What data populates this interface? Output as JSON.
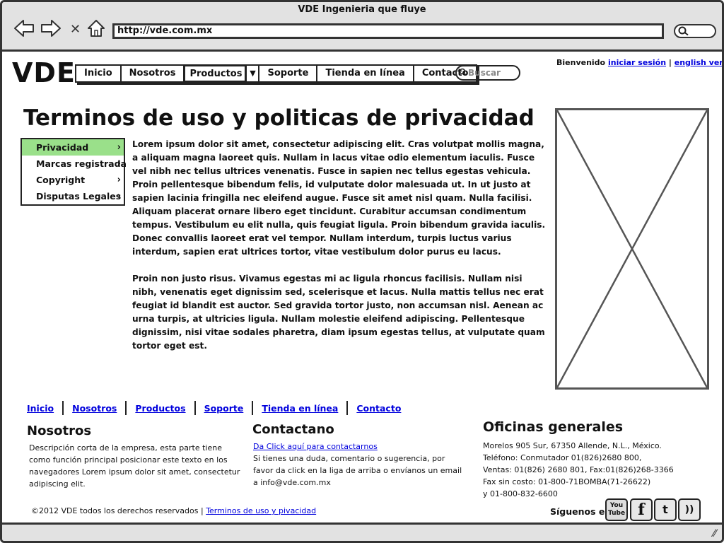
{
  "window": {
    "title": "VDE Ingenieria que fluye"
  },
  "browser": {
    "url": "http://vde.com.mx",
    "icons": [
      "back-arrow-icon",
      "forward-arrow-icon",
      "stop-icon",
      "home-icon",
      "search-icon"
    ],
    "stop_glyph": "✕"
  },
  "header": {
    "logo": "VDE",
    "nav": [
      "Inicio",
      "Nosotros",
      "Productos",
      "Soporte",
      "Tienda en línea",
      "Contacto"
    ],
    "search_placeholder": "Buscar",
    "welcome_text": "Bienvenido",
    "login_link": "iniciar sesión",
    "separator": "|",
    "english_link": "english version"
  },
  "main": {
    "title": "Terminos de uso y politicas de privacidad",
    "sidemenu": [
      {
        "label": "Privacidad",
        "active": true
      },
      {
        "label": "Marcas registrada",
        "active": false
      },
      {
        "label": "Copyright",
        "active": false
      },
      {
        "label": "Disputas Legales",
        "active": false
      }
    ],
    "paragraphs": [
      "Lorem ipsum dolor sit amet, consectetur adipiscing elit. Cras volutpat mollis magna, a aliquam magna laoreet quis. Nullam in lacus vitae odio elementum iaculis. Fusce vel nibh nec tellus ultrices venenatis. Fusce in sapien nec tellus egestas vehicula. Proin pellentesque bibendum felis, id vulputate dolor malesuada ut. In ut justo at sapien lacinia fringilla nec eleifend augue. Fusce sit amet nisl quam. Nulla facilisi. Aliquam placerat ornare libero eget tincidunt. Curabitur accumsan condimentum tempus. Vestibulum eu elit nulla, quis feugiat ligula. Proin bibendum gravida iaculis. Donec convallis laoreet erat vel tempor. Nullam interdum, turpis luctus varius interdum, sapien erat ultrices tortor, vitae vestibulum dolor purus eu lacus.",
      "Proin non justo risus. Vivamus egestas mi ac ligula rhoncus facilisis. Nullam nisi nibh, venenatis eget dignissim sed, scelerisque et lacus. Nulla mattis tellus nec erat feugiat id blandit est auctor. Sed gravida tortor justo, non accumsan nisl. Aenean ac urna turpis, at ultricies ligula. Nullam molestie eleifend adipiscing. Pellentesque dignissim, nisi vitae sodales pharetra, diam ipsum egestas tellus, at vulputate quam tortor eget est."
    ]
  },
  "footer": {
    "nav": [
      "Inicio",
      "Nosotros",
      "Productos",
      "Soporte",
      "Tienda en línea",
      "Contacto"
    ],
    "about": {
      "title": "Nosotros",
      "text": "Descripción corta de la empresa, esta parte tiene como función principal posicionar este texto en los navegadores Lorem ipsum dolor sit amet, consectetur adipiscing elit."
    },
    "contact": {
      "title": "Contactano",
      "link": "Da Click aquí para contactarnos",
      "text": "Si tienes una duda, comentario o sugerencia, por favor da click en la liga de arriba o envíanos un email a info@vde.com.mx"
    },
    "offices": {
      "title": "Oficinas generales",
      "lines": [
        "Morelos 905 Sur, 67350 Allende, N.L., México.",
        "Teléfono: Conmutador 01(826)2680 800,",
        "Ventas: 01(826) 2680 801, Fax:01(826)268-3366",
        "Fax sin costo: 01-800-71BOMBA(71-26622)",
        "y 01-800-832-6600"
      ]
    },
    "copyright": "©2012 VDE todos los derechos reservados",
    "separator": "|",
    "terms_link": "Terminos de uso y pivacidad",
    "follow_label": "Síguenos en:",
    "social": [
      {
        "icon": "youtube-icon",
        "glyph": "You Tube"
      },
      {
        "icon": "facebook-icon",
        "glyph": "f"
      },
      {
        "icon": "twitter-icon",
        "glyph": "t"
      },
      {
        "icon": "rss-icon",
        "glyph": "))"
      }
    ]
  }
}
